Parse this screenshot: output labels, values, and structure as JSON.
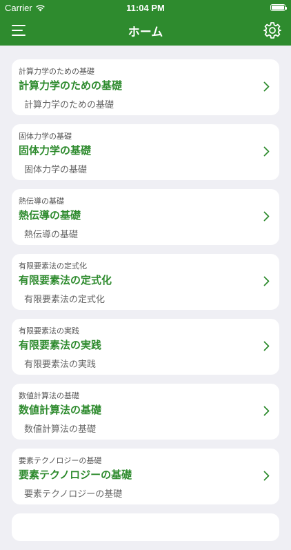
{
  "status_bar": {
    "carrier": "Carrier",
    "time": "11:04 PM",
    "icons": [
      "wifi-icon",
      "battery-icon"
    ]
  },
  "nav": {
    "title": "ホーム",
    "icons": [
      "hamburger-menu-icon",
      "gear-icon"
    ]
  },
  "colors": {
    "accent": "#2e8b2e",
    "background": "#efeff4",
    "card": "#ffffff"
  },
  "cards": [
    {
      "caption": "計算力学のための基礎",
      "title": "計算力学のための基礎",
      "subtitle": "計算力学のための基礎"
    },
    {
      "caption": "固体力学の基礎",
      "title": "固体力学の基礎",
      "subtitle": "固体力学の基礎"
    },
    {
      "caption": "熱伝導の基礎",
      "title": "熱伝導の基礎",
      "subtitle": "熱伝導の基礎"
    },
    {
      "caption": "有限要素法の定式化",
      "title": "有限要素法の定式化",
      "subtitle": "有限要素法の定式化"
    },
    {
      "caption": "有限要素法の実践",
      "title": "有限要素法の実践",
      "subtitle": "有限要素法の実践"
    },
    {
      "caption": "数値計算法の基礎",
      "title": "数値計算法の基礎",
      "subtitle": "数値計算法の基礎"
    },
    {
      "caption": "要素テクノロジーの基礎",
      "title": "要素テクノロジーの基礎",
      "subtitle": "要素テクノロジーの基礎"
    }
  ]
}
